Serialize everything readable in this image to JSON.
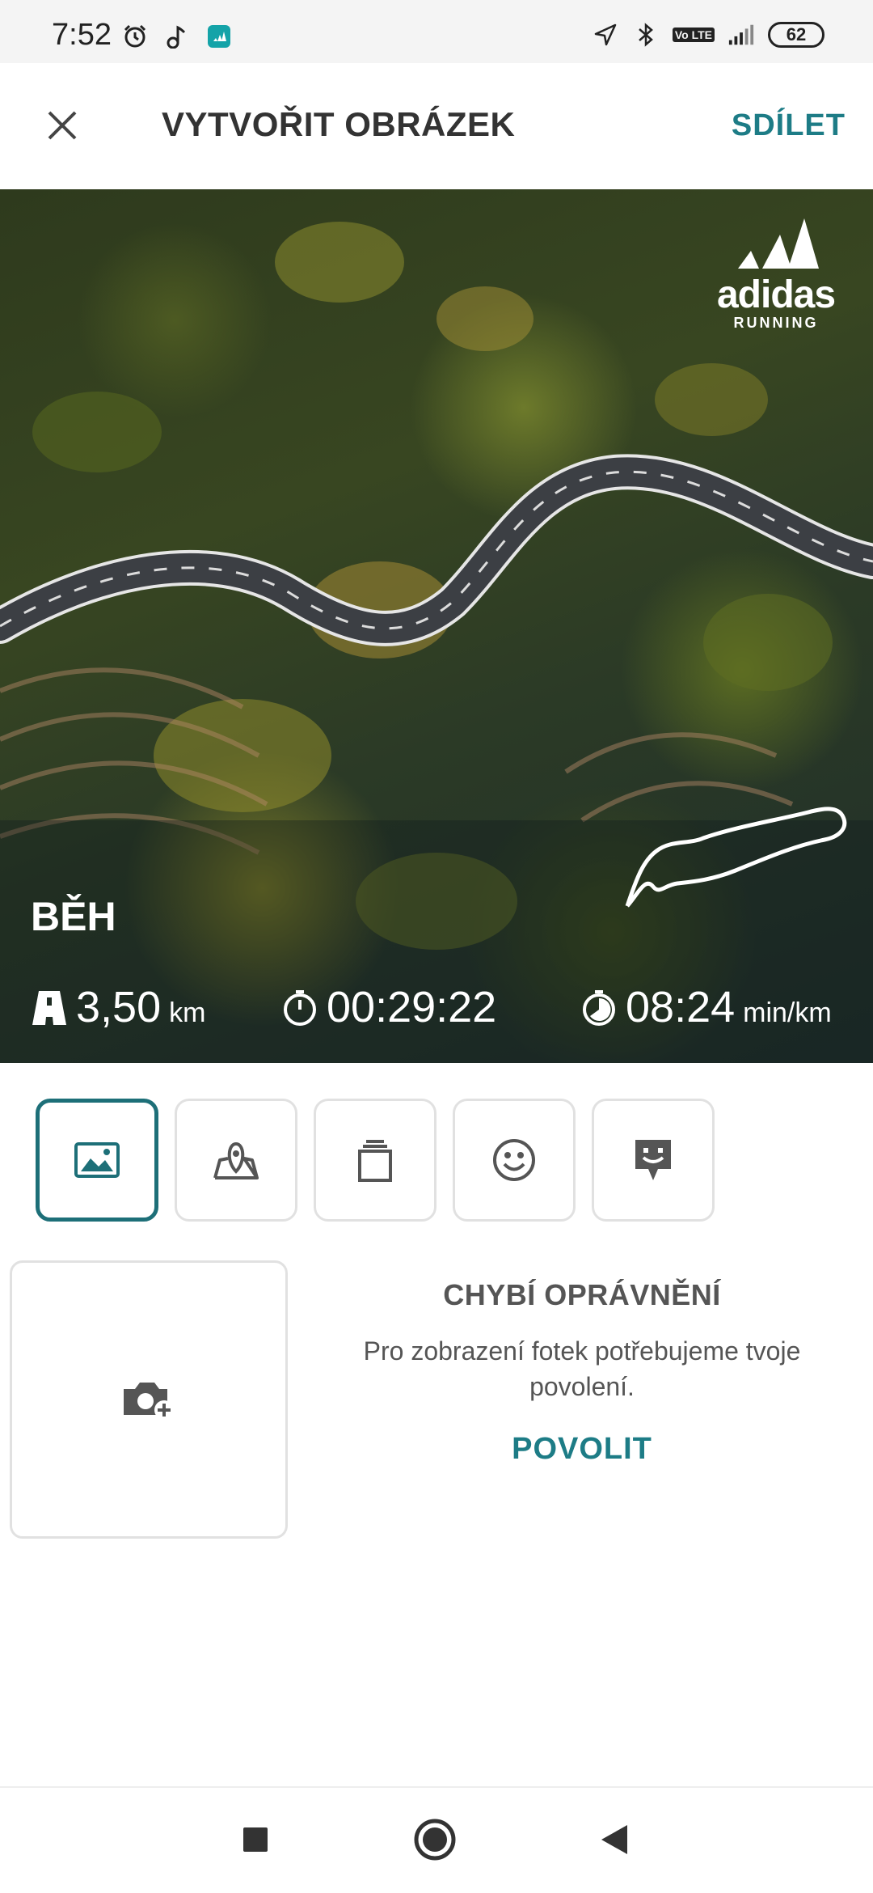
{
  "status_bar": {
    "time": "7:52",
    "battery": "62",
    "network_badge": "Vo LTE",
    "icons_left": [
      "alarm-icon",
      "music-note-icon",
      "adidas-app-icon"
    ],
    "icons_right": [
      "location-arrow-icon",
      "bluetooth-icon",
      "volte-icon",
      "signal-icon",
      "battery-icon"
    ]
  },
  "app_bar": {
    "title": "VYTVOŘIT OBRÁZEK",
    "share_label": "SDÍLET",
    "close_icon": "close-icon"
  },
  "preview": {
    "brand_word": "adidas",
    "brand_sub": "RUNNING",
    "activity": "BĚH",
    "stats": [
      {
        "icon": "road-icon",
        "value": "3,50",
        "unit": "km"
      },
      {
        "icon": "stopwatch-icon",
        "value": "00:29:22",
        "unit": ""
      },
      {
        "icon": "pace-icon",
        "value": "08:24",
        "unit": "min/km"
      }
    ]
  },
  "tools": [
    {
      "icon": "image-icon",
      "active": true
    },
    {
      "icon": "map-pin-icon",
      "active": false
    },
    {
      "icon": "layers-icon",
      "active": false
    },
    {
      "icon": "smiley-icon",
      "active": false
    },
    {
      "icon": "sticker-icon",
      "active": false
    }
  ],
  "permission": {
    "title": "CHYBÍ OPRÁVNĚNÍ",
    "text": "Pro zobrazení fotek potřebujeme tvoje povolení.",
    "button": "POVOLIT"
  },
  "colors": {
    "accent": "#1d7c86",
    "active_border": "#1d6f78",
    "border": "#e1e1e1"
  },
  "nav_bar": {
    "buttons": [
      "recents-icon",
      "home-icon",
      "back-icon"
    ]
  }
}
